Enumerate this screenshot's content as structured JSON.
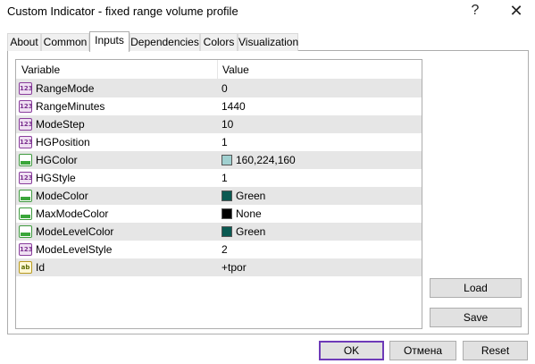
{
  "window": {
    "title": "Custom Indicator - fixed range volume profile",
    "help_label": "?",
    "close_label": "✕"
  },
  "tabs": [
    {
      "label": "About"
    },
    {
      "label": "Common"
    },
    {
      "label": "Inputs",
      "active": true
    },
    {
      "label": "Dependencies"
    },
    {
      "label": "Colors"
    },
    {
      "label": "Visualization"
    }
  ],
  "grid": {
    "col_variable": "Variable",
    "col_value": "Value",
    "rows": [
      {
        "type": "number",
        "icon": "123",
        "name": "RangeMode",
        "value": "0"
      },
      {
        "type": "number",
        "icon": "123",
        "name": "RangeMinutes",
        "value": "1440"
      },
      {
        "type": "number",
        "icon": "123",
        "name": "ModeStep",
        "value": "10"
      },
      {
        "type": "number",
        "icon": "123",
        "name": "HGPosition",
        "value": "1"
      },
      {
        "type": "color",
        "name": "HGColor",
        "value": "160,224,160",
        "swatch": "#a0d0d0"
      },
      {
        "type": "number",
        "icon": "123",
        "name": "HGStyle",
        "value": "1"
      },
      {
        "type": "color",
        "name": "ModeColor",
        "value": "Green",
        "swatch": "#0b5a52"
      },
      {
        "type": "color",
        "name": "MaxModeColor",
        "value": "None",
        "swatch": "#000000"
      },
      {
        "type": "color",
        "name": "ModeLevelColor",
        "value": "Green",
        "swatch": "#0b5a52"
      },
      {
        "type": "number",
        "icon": "123",
        "name": "ModeLevelStyle",
        "value": "2"
      },
      {
        "type": "string",
        "icon": "ab",
        "name": "Id",
        "value": "+tpor"
      }
    ]
  },
  "buttons": {
    "load": "Load",
    "save": "Save",
    "ok": "OK",
    "cancel": "Отмена",
    "reset": "Reset"
  },
  "colors": {
    "accent": "#6e3bb8",
    "alt_row": "#e6e6e6",
    "button_bg": "#e1e1e1"
  }
}
